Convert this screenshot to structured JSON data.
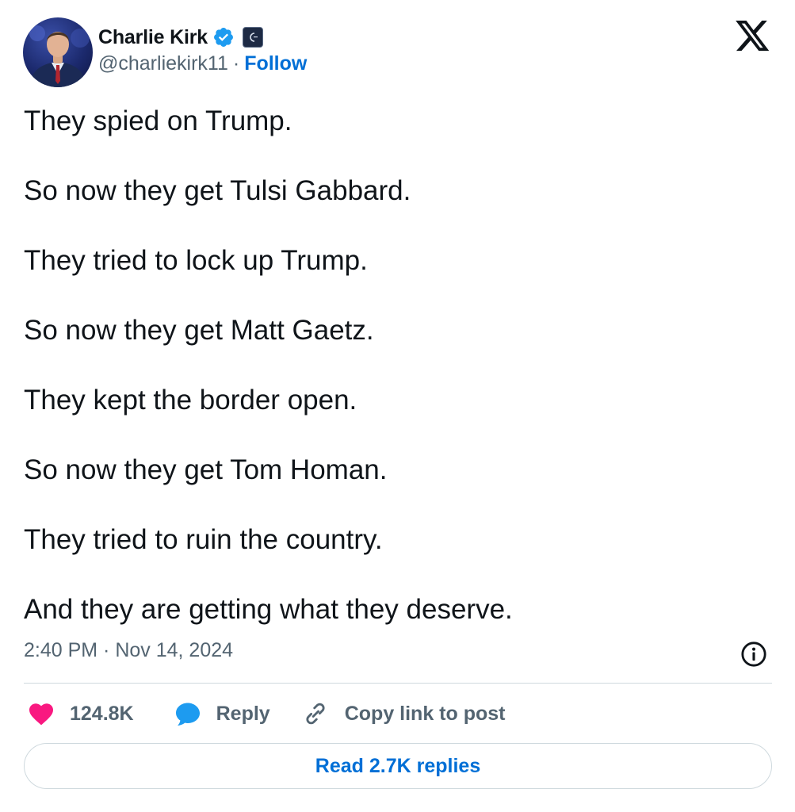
{
  "author": {
    "display_name": "Charlie Kirk",
    "handle": "@charliekirk11",
    "separator": "·",
    "follow_label": "Follow",
    "verified_color": "#1d9bf0"
  },
  "tweet": {
    "lines": [
      "They spied on Trump.",
      "So now they get Tulsi Gabbard.",
      "They tried to lock up Trump.",
      "So now they get Matt Gaetz.",
      "They kept the border open.",
      "So now they get Tom Homan.",
      "They tried to ruin the country.",
      "And they are getting what they deserve."
    ],
    "timestamp": "2:40 PM · Nov 14, 2024"
  },
  "actions": {
    "like_count": "124.8K",
    "reply_label": "Reply",
    "copy_link_label": "Copy link to post",
    "read_replies_label": "Read 2.7K replies"
  },
  "colors": {
    "text": "#0f1419",
    "secondary": "#536471",
    "link": "#006fd6",
    "like": "#f91880",
    "reply": "#1d9bf0",
    "border": "#cfd9de"
  },
  "icons": {
    "brand": "x-logo-icon",
    "info": "info-icon",
    "like": "heart-icon",
    "reply": "speech-bubble-icon",
    "copy": "link-icon"
  }
}
